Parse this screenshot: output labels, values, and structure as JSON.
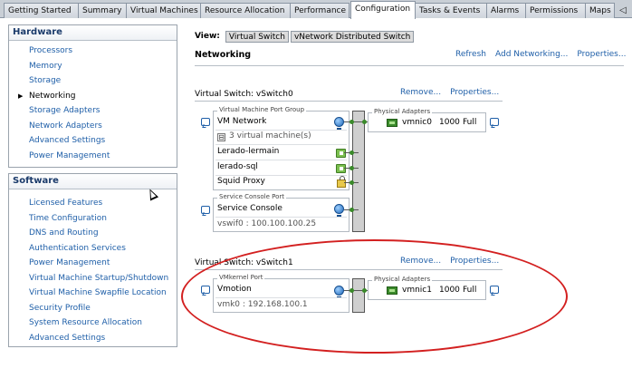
{
  "tabs": [
    {
      "label": "Getting Started"
    },
    {
      "label": "Summary"
    },
    {
      "label": "Virtual Machines"
    },
    {
      "label": "Resource Allocation"
    },
    {
      "label": "Performance"
    },
    {
      "label": "Configuration"
    },
    {
      "label": "Tasks & Events"
    },
    {
      "label": "Alarms"
    },
    {
      "label": "Permissions"
    },
    {
      "label": "Maps"
    },
    {
      "label": "◁"
    }
  ],
  "hardware": {
    "title": "Hardware",
    "items": [
      "Processors",
      "Memory",
      "Storage",
      "Networking",
      "Storage Adapters",
      "Network Adapters",
      "Advanced Settings",
      "Power Management"
    ],
    "bullet": "▶"
  },
  "software": {
    "title": "Software",
    "items": [
      "Licensed Features",
      "Time Configuration",
      "DNS and Routing",
      "Authentication Services",
      "Power Management",
      "Virtual Machine Startup/Shutdown",
      "Virtual Machine Swapfile Location",
      "Security Profile",
      "System Resource Allocation",
      "Advanced Settings"
    ]
  },
  "view": {
    "label": "View:",
    "options": [
      "Virtual Switch",
      "vNetwork Distributed Switch"
    ]
  },
  "networking": {
    "title": "Networking",
    "actions": [
      "Refresh",
      "Add Networking...",
      "Properties..."
    ]
  },
  "vswitch0": {
    "label": "Virtual Switch: vSwitch0",
    "actions": [
      "Remove...",
      "Properties..."
    ],
    "vm_group_title": "Virtual Machine Port Group",
    "vm_network": "VM Network",
    "vm_count": "3 virtual machine(s)",
    "expander": "⊟",
    "vms": [
      "Lerado-lermain",
      "lerado-sql",
      "Squid Proxy"
    ],
    "sc_group_title": "Service Console Port",
    "service_console": "Service Console",
    "vswif": "vswif0 : 100.100.100.25",
    "phys_title": "Physical Adapters",
    "nic": "vmnic0",
    "speed": "1000",
    "duplex": "Full"
  },
  "vswitch1": {
    "label": "Virtual Switch: vSwitch1",
    "actions": [
      "Remove...",
      "Properties..."
    ],
    "vmk_group_title": "VMkernel Port",
    "vmotion": "Vmotion",
    "vmk": "vmk0 : 192.168.100.1",
    "phys_title": "Physical Adapters",
    "nic": "vmnic1",
    "speed": "1000",
    "duplex": "Full"
  },
  "colors": {
    "link": "#1f5fa8",
    "annotation": "#d32020"
  }
}
